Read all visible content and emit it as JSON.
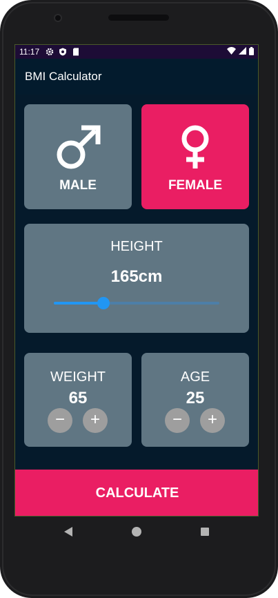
{
  "status_bar": {
    "time": "11:17",
    "icons_left": [
      "settings-icon",
      "shield-icon",
      "sd-card-icon"
    ],
    "icons_right": [
      "wifi-icon",
      "cellular-icon",
      "battery-icon"
    ]
  },
  "app_bar": {
    "title": "BMI Calculator"
  },
  "gender": {
    "selected": "female",
    "male_label": "MALE",
    "female_label": "FEMALE",
    "male_icon": "male-symbol-icon",
    "female_icon": "female-symbol-icon"
  },
  "height": {
    "label": "HEIGHT",
    "value_text": "165cm",
    "slider_fraction": 0.3
  },
  "weight": {
    "label": "WEIGHT",
    "value": "65",
    "minus": "−",
    "plus": "+"
  },
  "age": {
    "label": "AGE",
    "value": "25",
    "minus": "−",
    "plus": "+"
  },
  "calculate_label": "CALCULATE",
  "colors": {
    "background": "#051a2b",
    "card": "#607683",
    "accent": "#ea1e63",
    "slider": "#2196f3"
  },
  "nav_bar": {
    "icons": [
      "back-icon",
      "home-icon",
      "recents-icon"
    ]
  }
}
